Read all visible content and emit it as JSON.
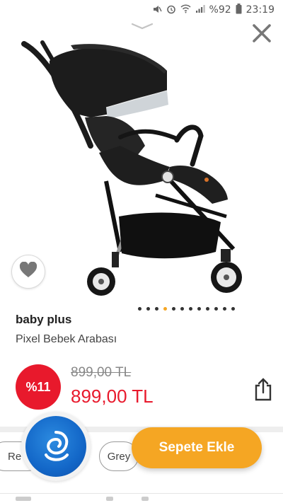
{
  "status_bar": {
    "battery": "%92",
    "time": "23:19",
    "icons": [
      "mute-icon",
      "alarm-icon",
      "wifi-icon",
      "signal-icon",
      "battery-icon"
    ]
  },
  "navigation": {
    "dismiss_icon": "chevron-down-icon",
    "close_icon": "close-icon"
  },
  "gallery": {
    "image_subject": "stroller",
    "total_images": 12,
    "active_index": 3,
    "favorite_icon": "heart-icon"
  },
  "product": {
    "brand": "baby plus",
    "name": "Pixel Bebek Arabası",
    "discount": "%11",
    "old_price": "899,00 TL",
    "price": "899,00 TL",
    "share_icon": "share-icon"
  },
  "variants": {
    "chips": [
      "Re",
      "Grey"
    ]
  },
  "actions": {
    "add_to_cart": "Sepete Ekle",
    "assistant_icon": "assistant-logo-icon"
  },
  "colors": {
    "accent": "#f5a623",
    "price_red": "#e8192c",
    "assistant_blue": "#1367c8"
  }
}
